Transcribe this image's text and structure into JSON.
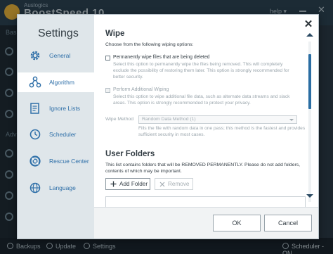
{
  "app": {
    "brand_small": "Auslogics",
    "brand": "BoostSpeed 10",
    "help": "help",
    "help_arrow": "▾",
    "sidebar_labels": [
      "Bas",
      "Adv"
    ],
    "footer": {
      "backups": "Backups",
      "update": "Update",
      "settings": "Settings",
      "scheduler": "Scheduler - ON"
    }
  },
  "dialog": {
    "title": "Settings",
    "close_glyph": "✕",
    "nav": [
      {
        "label": "General",
        "icon": "gear-icon"
      },
      {
        "label": "Algorithm",
        "icon": "algorithm-icon",
        "active": true
      },
      {
        "label": "Ignore Lists",
        "icon": "ignore-list-icon"
      },
      {
        "label": "Scheduler",
        "icon": "clock-icon"
      },
      {
        "label": "Rescue Center",
        "icon": "rescue-center-icon"
      },
      {
        "label": "Language",
        "icon": "globe-icon"
      }
    ],
    "wipe": {
      "title": "Wipe",
      "intro": "Choose from the following wiping options:",
      "option1_label": "Permanently wipe files that are being deleted",
      "option1_desc": [
        "Select this option to permanently wipe the files being removed. This will completely",
        "exclude the possibility of restoring them later. This option is strongly recommended for",
        "better security."
      ],
      "option2_label": "Perform Additional Wiping",
      "option2_desc": [
        "Select this option to wipe additional file data, such as alternate data streams and slack",
        "areas. This option is strongly recommended to protect your privacy."
      ],
      "method_label": "Wipe Method",
      "method_value": "Random Data Method (1)",
      "method_desc": [
        "Fills the file with random data in one pass; this method is the fastest and provides",
        "sufficient security in most cases."
      ]
    },
    "user_folders": {
      "title": "User Folders",
      "desc": [
        "This list contains folders that will be REMOVED PERMANENTLY. Please do not add folders,",
        "contents of which may be important."
      ],
      "add_button": "Add Folder",
      "remove_button": "Remove"
    },
    "ok": "OK",
    "cancel": "Cancel"
  },
  "colors": {
    "accent": "#2b6ea3",
    "nav_text": "#2e6fa8",
    "sidebar_bg": "#dfe6ea"
  }
}
